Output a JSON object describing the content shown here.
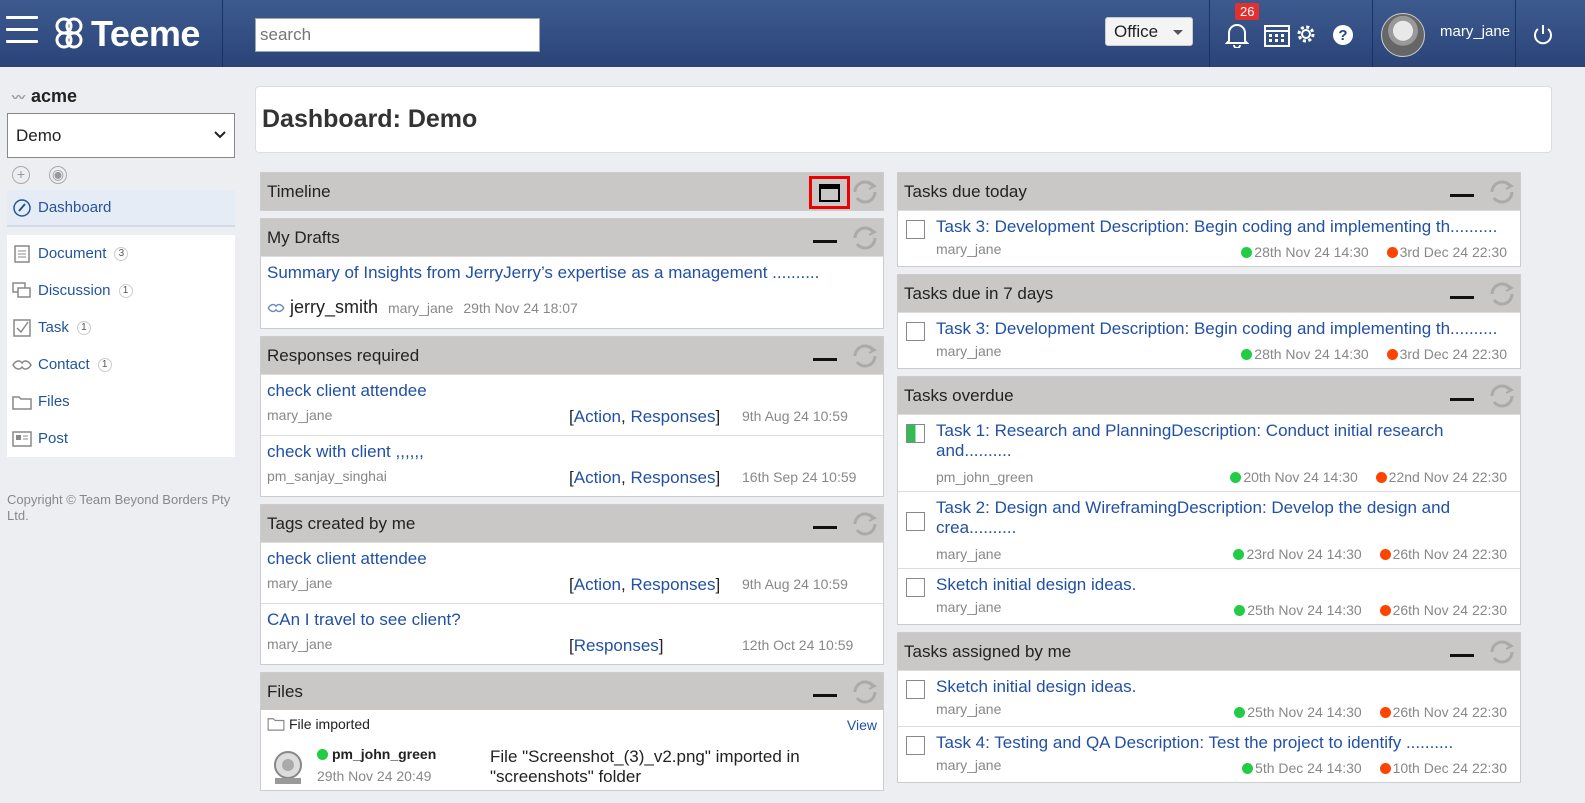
{
  "header": {
    "app_name": "Teeme",
    "search_placeholder": "search",
    "office_label": "Office",
    "notification_count": "26",
    "username": "mary_jane"
  },
  "sidebar": {
    "org_name": "acme",
    "workspace": "Demo",
    "items": [
      {
        "label": "Dashboard",
        "icon": "dashboard-icon",
        "count": ""
      },
      {
        "label": "Document",
        "icon": "document-icon",
        "count": "3"
      },
      {
        "label": "Discussion",
        "icon": "discussion-icon",
        "count": "1"
      },
      {
        "label": "Task",
        "icon": "task-icon",
        "count": "1"
      },
      {
        "label": "Contact",
        "icon": "contact-icon",
        "count": "1"
      },
      {
        "label": "Files",
        "icon": "folder-icon",
        "count": ""
      },
      {
        "label": "Post",
        "icon": "post-icon",
        "count": ""
      }
    ],
    "copyright": "Copyright © Team Beyond Borders Pty Ltd."
  },
  "main": {
    "title": "Dashboard: Demo",
    "timeline": {
      "title": "Timeline"
    },
    "drafts": {
      "title": "My Drafts",
      "item": {
        "link": "Summary of Insights from JerryJerry’s expertise as a management ..........",
        "contact": "jerry_smith",
        "user": "mary_jane",
        "date": "29th Nov 24 18:07"
      }
    },
    "responses": {
      "title": "Responses required",
      "items": [
        {
          "link": "check client attendee",
          "user": "mary_jane",
          "action": "Action",
          "responses": "Responses",
          "date": "9th Aug 24 10:59"
        },
        {
          "link": "check with client ,,,,,,",
          "user": "pm_sanjay_singhai",
          "action": "Action",
          "responses": "Responses",
          "date": "16th Sep 24 10:59"
        }
      ]
    },
    "tags": {
      "title": "Tags created by me",
      "items": [
        {
          "link": "check client attendee",
          "user": "mary_jane",
          "action": "Action",
          "responses": "Responses",
          "date": "9th Aug 24 10:59"
        },
        {
          "link": "CAn I travel to see client?",
          "user": "mary_jane",
          "action": "",
          "responses": "Responses",
          "date": "12th Oct 24 10:59"
        }
      ]
    },
    "files": {
      "title": "Files",
      "event": "File imported",
      "view": "View",
      "user": "pm_john_green",
      "date": "29th Nov 24 20:49",
      "desc": "File \"Screenshot_(3)_v2.png\" imported in \"screenshots\" folder"
    },
    "due_today": {
      "title": "Tasks due today",
      "items": [
        {
          "link": "Task 3: Development Description: Begin coding and implementing th..........",
          "user": "mary_jane",
          "start": "28th Nov 24 14:30",
          "end": "3rd Dec 24 22:30"
        }
      ]
    },
    "due_7": {
      "title": "Tasks due in 7 days",
      "items": [
        {
          "link": "Task 3: Development Description: Begin coding and implementing th..........",
          "user": "mary_jane",
          "start": "28th Nov 24 14:30",
          "end": "3rd Dec 24 22:30"
        }
      ]
    },
    "overdue": {
      "title": "Tasks overdue",
      "items": [
        {
          "link": "Task 1: Research and PlanningDescription: Conduct initial research and..........",
          "user": "pm_john_green",
          "start": "20th Nov 24 14:30",
          "end": "22nd Nov 24 22:30"
        },
        {
          "link": "Task 2: Design and WireframingDescription: Develop the design and crea..........",
          "user": "mary_jane",
          "start": "23rd Nov 24 14:30",
          "end": "26th Nov 24 22:30"
        },
        {
          "link": "Sketch initial design ideas.",
          "user": "mary_jane",
          "start": "25th Nov 24 14:30",
          "end": "26th Nov 24 22:30"
        }
      ]
    },
    "assigned": {
      "title": "Tasks assigned by me",
      "items": [
        {
          "link": "Sketch initial design ideas.",
          "user": "mary_jane",
          "start": "25th Nov 24 14:30",
          "end": "26th Nov 24 22:30"
        },
        {
          "link": "Task 4: Testing and QA Description: Test the project to identify ..........",
          "user": "mary_jane",
          "start": "5th Dec 24 14:30",
          "end": "10th Dec 24 22:30"
        }
      ]
    }
  }
}
